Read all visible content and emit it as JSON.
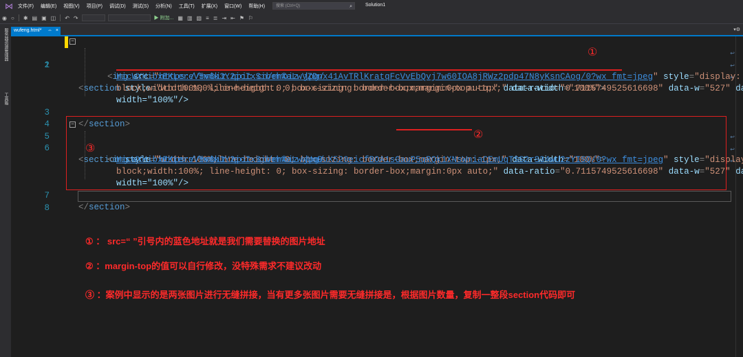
{
  "menubar": {
    "items": [
      "文件(F)",
      "编辑(E)",
      "视图(V)",
      "项目(P)",
      "调试(D)",
      "测试(S)",
      "分析(N)",
      "工具(T)",
      "扩展(X)",
      "窗口(W)",
      "帮助(H)"
    ],
    "search_placeholder": "搜索 (Ctrl+Q)",
    "solution_label": "Solution1"
  },
  "toolbar": {
    "attach_label": "▶ 附加..."
  },
  "left_strip": {
    "labels": [
      "服务器资源管理器",
      "工具箱"
    ]
  },
  "tab": {
    "filename": "wufeng.html*",
    "pin_glyph": "⇔",
    "close_glyph": "×"
  },
  "editor": {
    "line_numbers": [
      "1",
      "2",
      "3",
      "4",
      "5",
      "6",
      "7",
      "8"
    ],
    "section_open": "section",
    "img_tag": "img",
    "section_close": "section",
    "attr_style": "style",
    "attr_data_width": "data-width",
    "attr_src": "src",
    "attr_data_ratio": "data-ratio",
    "attr_data_w": "data-w",
    "section_style_part1": "\"width:100%;line-height: 0; box-sizing: border-box;",
    "section_style_margin": "margin-top:-1px;",
    "section_style_end": "\"",
    "data_width_value": "\"100%\"",
    "url_prefix": "https://mmbiz.qpic.cn/mmbiz_jpg/",
    "url1_tail": "HicWXHibxEKLereV5v6k3Y2icIxSibehXaLwVZDnx41AvTRlKratqFcVvEbQvj7w60IOA8jRWz2pdp47N8yKsnCAog/0?wx_fmt=jpeg",
    "url2_tail": "HicWXHibxEKLereV5v6k3Y2icIxSibehXaLwWUqBuX520eicfBOA1sGauP5qRQk1XNsWniaCEmUqTSS2rS34wU2zYISQ/0?wx_fmt=jpeg",
    "img_style_value_start": "\"display:",
    "img_style_value_cont": "block;width:100%; line-height: 0; box-sizing: border-box;margin:0px auto;\"",
    "data_ratio_value": "\"0.7115749525616698\"",
    "data_w_value": "\"527\"",
    "data_width_wrapped": "width=\"100%\"/>"
  },
  "annotations": {
    "circle1": "①",
    "circle2": "②",
    "circle3": "③"
  },
  "notes": [
    "① ： src=“  ”引号内的蓝色地址就是我们需要替换的图片地址",
    "② ：margin-top的值可以自行修改，没特殊需求不建议改动",
    "③ ：案例中显示的是两张图片进行无缝拼接，当有更多张图片需要无缝拼接是，根据图片数量，复制一整段section代码即可"
  ],
  "colors": {
    "accent": "#007acc",
    "annotation_red": "#e02020"
  }
}
